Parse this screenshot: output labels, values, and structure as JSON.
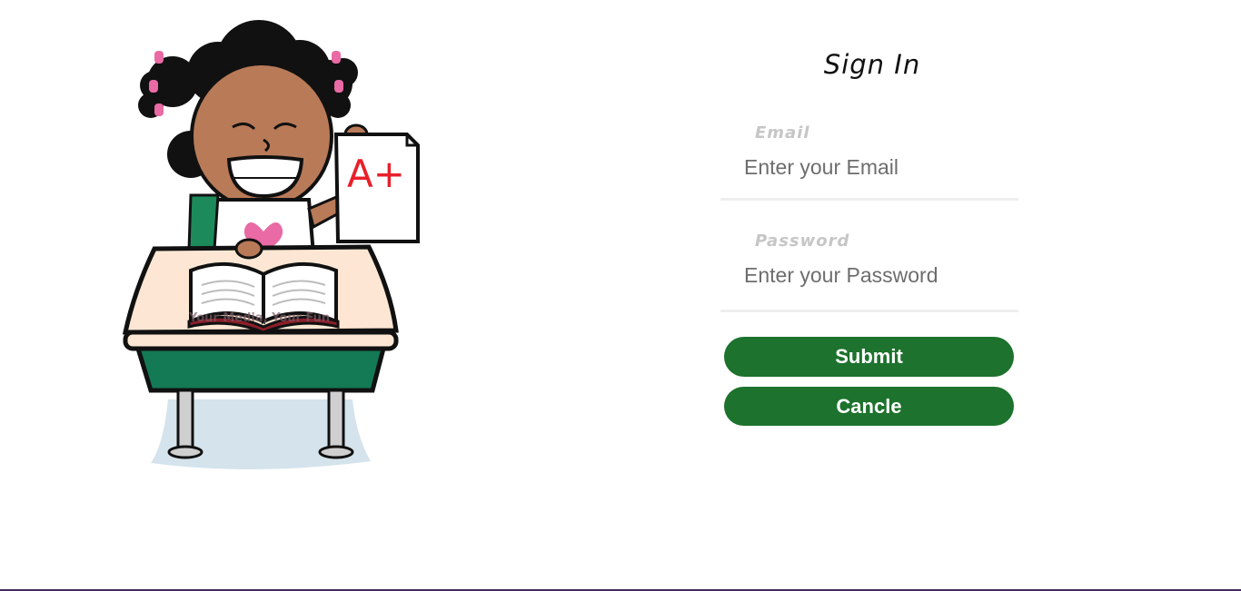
{
  "form": {
    "title": "Sign In",
    "email": {
      "label": "Email",
      "placeholder": "Enter your Email",
      "value": ""
    },
    "password": {
      "label": "Password",
      "placeholder": "Enter your Password",
      "value": ""
    },
    "submit_label": "Submit",
    "cancel_label": "Cancle"
  },
  "illustration": {
    "grade_text": "A+",
    "watermark_text": "Your Media, Your Fun"
  },
  "colors": {
    "button_bg": "#1d722d",
    "button_text": "#ffffff",
    "label": "#c6c6c6",
    "underline": "#eeeeee",
    "desk_front": "#137a55",
    "desk_top": "#fde7d4",
    "skin": "#b97a58",
    "grade_red": "#e8202a",
    "footer_border": "#4a2a5a"
  }
}
